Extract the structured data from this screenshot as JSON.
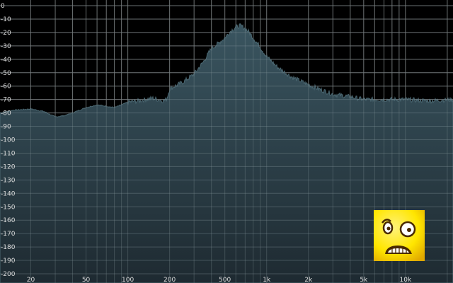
{
  "analyzer": {
    "db_labels": [
      "0",
      "-10",
      "-20",
      "-30",
      "-40",
      "-50",
      "-60",
      "-70",
      "-80",
      "-90",
      "-100",
      "-110",
      "-120",
      "-130",
      "-140",
      "-150",
      "-160",
      "-170",
      "-180",
      "-190",
      "-200"
    ],
    "db_values": [
      0,
      -10,
      -20,
      -30,
      -40,
      -50,
      -60,
      -70,
      -80,
      -90,
      -100,
      -110,
      -120,
      -130,
      -140,
      -150,
      -160,
      -170,
      -180,
      -190,
      -200
    ],
    "freq_labels": [
      {
        "f": 20,
        "text": "20"
      },
      {
        "f": 50,
        "text": "50"
      },
      {
        "f": 100,
        "text": "100"
      },
      {
        "f": 200,
        "text": "200"
      },
      {
        "f": 500,
        "text": "500"
      },
      {
        "f": 1000,
        "text": "1k"
      },
      {
        "f": 2000,
        "text": "2k"
      },
      {
        "f": 5000,
        "text": "5k"
      },
      {
        "f": 10000,
        "text": "10k"
      }
    ],
    "freq_range_hz": [
      12,
      22000
    ],
    "db_range": [
      0,
      -200
    ],
    "colors": {
      "background": "#000000",
      "grid": "#5a5a5a",
      "fill_top": "#3a5560",
      "fill_bottom": "#1e2a31",
      "edge": "#4a6670"
    }
  },
  "chart_data": {
    "type": "area",
    "title": "",
    "xlabel": "",
    "ylabel": "",
    "xscale": "log",
    "xlim": [
      12,
      22000
    ],
    "ylim": [
      -200,
      0
    ],
    "grid": true,
    "series": [
      {
        "x": [
          12,
          15,
          20,
          25,
          30,
          35,
          40,
          50,
          60,
          70,
          80,
          90,
          100,
          120,
          150,
          180,
          190,
          200,
          250,
          300,
          350,
          400,
          450,
          500,
          550,
          600,
          650,
          700,
          750,
          800,
          900,
          1000,
          1200,
          1500,
          2000,
          2500,
          3000,
          4000,
          5000,
          7000,
          10000,
          15000,
          22000
        ],
        "values": [
          -80,
          -78,
          -77,
          -79,
          -83,
          -82,
          -80,
          -76,
          -74,
          -75,
          -76,
          -74,
          -72,
          -71,
          -69,
          -71,
          -70,
          -62,
          -57,
          -51,
          -42,
          -32,
          -28,
          -24,
          -19,
          -16,
          -15,
          -17,
          -20,
          -24,
          -31,
          -38,
          -46,
          -53,
          -59,
          -63,
          -66,
          -68,
          -70,
          -70,
          -70,
          -71,
          -70
        ]
      }
    ]
  },
  "mascot": {
    "icon": "scared-face-icon",
    "colors": {
      "face": "#ffe600",
      "face_dark": "#e0a800",
      "outline": "#4a2a00"
    }
  }
}
